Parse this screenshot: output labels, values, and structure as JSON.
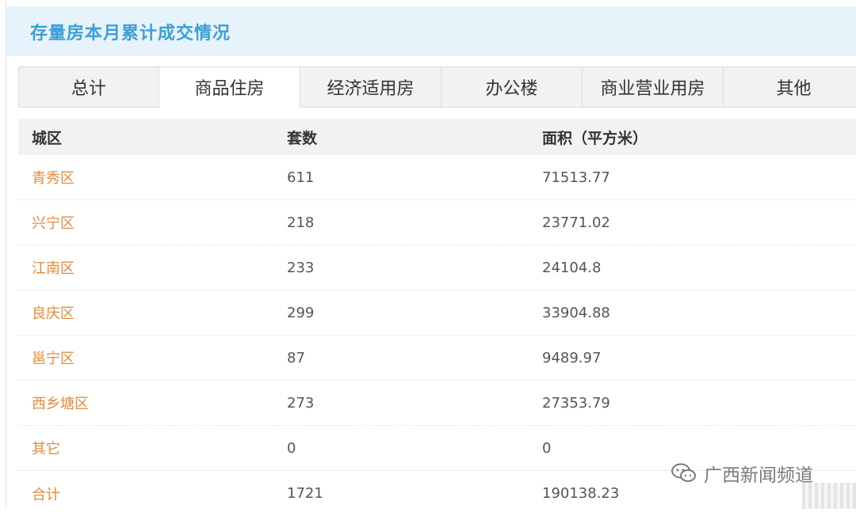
{
  "title": "存量房本月累计成交情况",
  "tabs": [
    {
      "label": "总计",
      "active": false
    },
    {
      "label": "商品住房",
      "active": true
    },
    {
      "label": "经济适用房",
      "active": false
    },
    {
      "label": "办公楼",
      "active": false
    },
    {
      "label": "商业营业用房",
      "active": false
    },
    {
      "label": "其他",
      "active": false
    }
  ],
  "table": {
    "headers": [
      "城区",
      "套数",
      "面积（平方米）"
    ],
    "rows": [
      [
        "青秀区",
        "611",
        "71513.77"
      ],
      [
        "兴宁区",
        "218",
        "23771.02"
      ],
      [
        "江南区",
        "233",
        "24104.8"
      ],
      [
        "良庆区",
        "299",
        "33904.88"
      ],
      [
        "邕宁区",
        "87",
        "9489.97"
      ],
      [
        "西乡塘区",
        "273",
        "27353.79"
      ],
      [
        "其它",
        "0",
        "0"
      ],
      [
        "合计",
        "1721",
        "190138.23"
      ]
    ]
  },
  "watermark": {
    "text": "广西新闻频道",
    "icon": "wechat-icon"
  },
  "colors": {
    "title": "#3b9fd6",
    "title_bg": "#e6f3fb",
    "district_link": "#e58a3b",
    "header_bg": "#f2f2f2"
  }
}
